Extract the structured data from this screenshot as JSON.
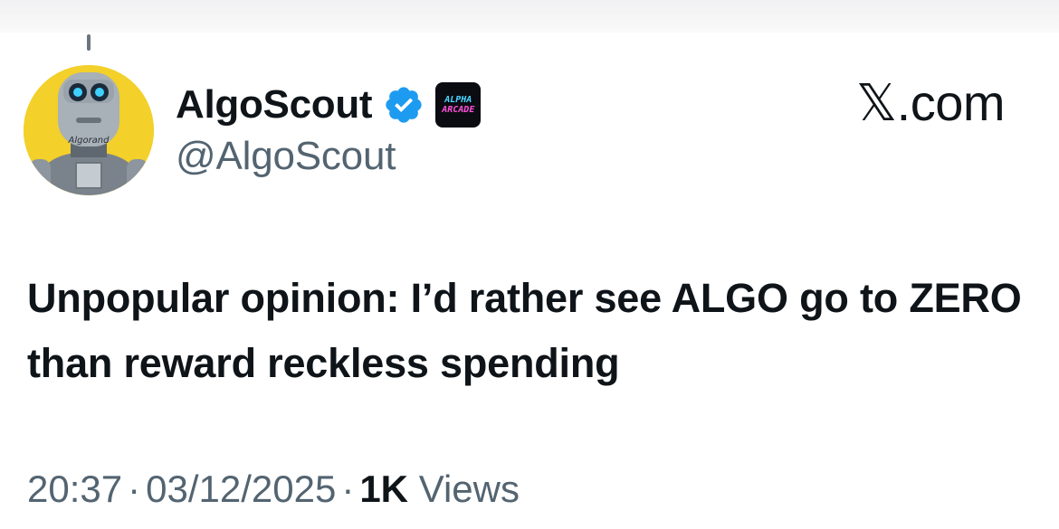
{
  "header": {
    "brand": "𝕏.com"
  },
  "author": {
    "display_name": "AlgoScout",
    "handle": "@AlgoScout",
    "avatar_icon": "robot-avatar-icon",
    "avatar_text": "Algorand",
    "verified_icon": "verified-badge-icon",
    "verified_color": "#1d9bf0",
    "affiliate_badge": {
      "line1": "ALPHA",
      "line2": "ARCADE"
    }
  },
  "tweet": {
    "text": "Unpopular opinion: I’d rather see ALGO go to ZERO than reward reckless spending"
  },
  "meta": {
    "time": "20:37",
    "date": "03/12/2025",
    "views_count": "1K",
    "views_label": "Views",
    "separator": "·"
  },
  "colors": {
    "text_primary": "#0f1419",
    "text_secondary": "#536471",
    "avatar_background": "#f3d02a"
  }
}
